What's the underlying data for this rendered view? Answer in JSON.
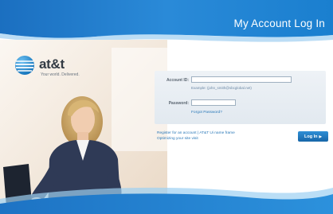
{
  "header": {
    "title": "My Account Log In"
  },
  "logo": {
    "wordmark": "at&t",
    "tagline": "Your world. Delivered."
  },
  "login": {
    "account_id_label": "Account ID:",
    "account_id_value": "",
    "account_id_hint": "Example: (john_smith@sbcglobal.net)",
    "password_label": "Password:",
    "password_value": "",
    "forgot_password": "Forgot Password?",
    "register_text": "Register for an account | AT&T Ui name frame",
    "optimizing_text": "Optimizing your site visit",
    "login_button": "Log In",
    "login_button_arrow": "▶"
  },
  "colors": {
    "header_blue": "#1a7fcf",
    "header_blue_light": "#36a2e6",
    "button_blue": "#1e78c2",
    "link_blue": "#2a78b8"
  },
  "icons": {
    "logo": "att-globe-icon",
    "button_arrow": "right-triangle-icon"
  }
}
